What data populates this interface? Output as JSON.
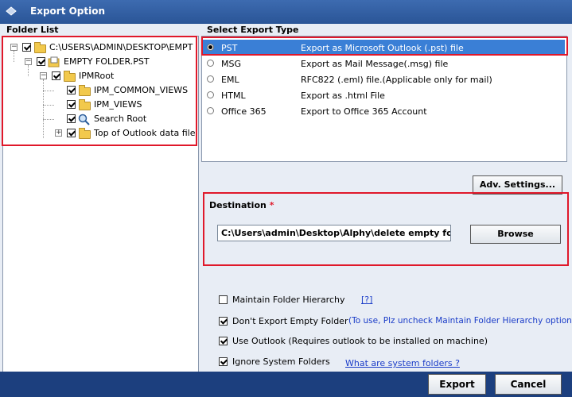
{
  "window": {
    "title": "Export Option"
  },
  "folder_list": {
    "header": "Folder List",
    "tree": [
      {
        "label": "C:\\USERS\\ADMIN\\DESKTOP\\EMPT",
        "checked": true,
        "icon": "folder-open-icon"
      },
      {
        "label": "EMPTY FOLDER.PST",
        "checked": true,
        "icon": "pst-file-icon"
      },
      {
        "label": "IPMRoot",
        "checked": true,
        "icon": "folder-icon"
      },
      {
        "label": "IPM_COMMON_VIEWS",
        "checked": true,
        "icon": "folder-icon"
      },
      {
        "label": "IPM_VIEWS",
        "checked": true,
        "icon": "folder-icon"
      },
      {
        "label": "Search Root",
        "checked": true,
        "icon": "search-icon"
      },
      {
        "label": "Top of Outlook data file",
        "checked": true,
        "icon": "folder-icon"
      }
    ]
  },
  "export_type": {
    "header": "Select Export Type",
    "options": [
      {
        "name": "PST",
        "desc": "Export as Microsoft Outlook (.pst) file",
        "selected": true
      },
      {
        "name": "MSG",
        "desc": "Export as Mail Message(.msg) file",
        "selected": false
      },
      {
        "name": "EML",
        "desc": "RFC822 (.eml) file.(Applicable only for mail)",
        "selected": false
      },
      {
        "name": "HTML",
        "desc": "Export as .html File",
        "selected": false
      },
      {
        "name": "Office 365",
        "desc": "Export to Office 365 Account",
        "selected": false
      }
    ]
  },
  "adv_settings_label": "Adv. Settings...",
  "destination": {
    "label": "Destination",
    "required_mark": "*",
    "path": "C:\\Users\\admin\\Desktop\\Alphy\\delete empty folders",
    "browse_label": "Browse"
  },
  "options": {
    "maintain_hierarchy": {
      "label": "Maintain Folder Hierarchy",
      "checked": false,
      "help": "[?]"
    },
    "dont_export_empty": {
      "label": "Don't Export Empty Folder",
      "checked": true,
      "note": "(To use, Plz uncheck Maintain Folder Hierarchy option)"
    },
    "use_outlook": {
      "label": "Use Outlook (Requires outlook to be installed on machine)",
      "checked": true
    },
    "ignore_system": {
      "label": "Ignore System Folders",
      "checked": true,
      "link": "What are system folders ?"
    }
  },
  "footer": {
    "export_label": "Export",
    "cancel_label": "Cancel"
  },
  "colors": {
    "title_bar": "#2a5597",
    "selection": "#3a7fd6",
    "highlight_border": "#e0182a",
    "link": "#1a3cc8"
  }
}
